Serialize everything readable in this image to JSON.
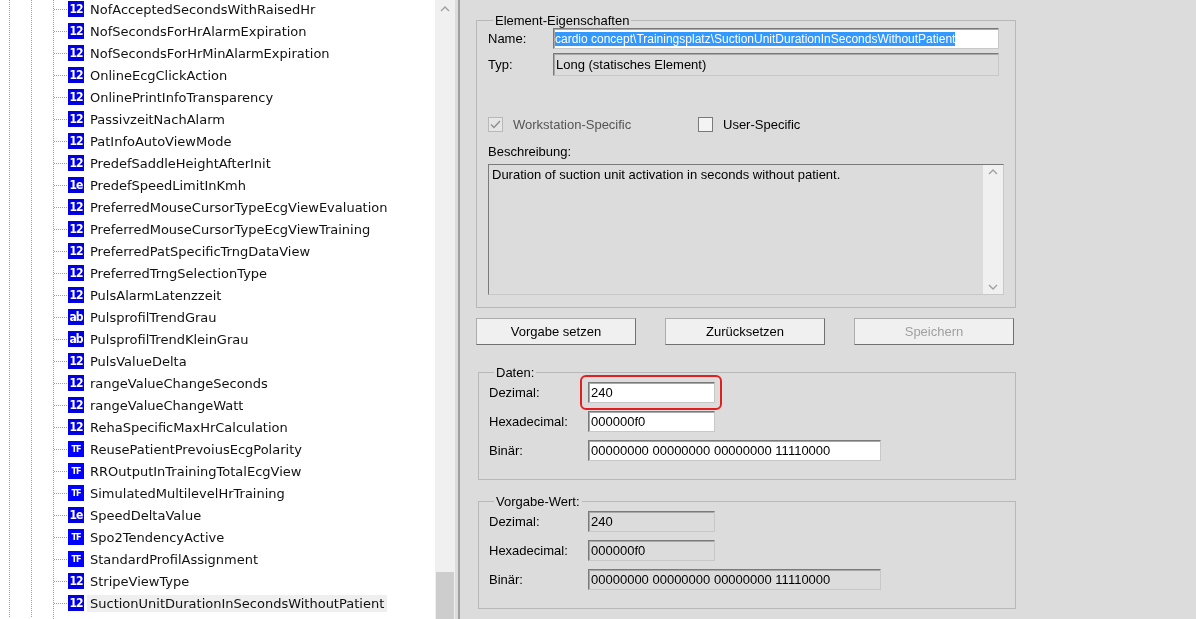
{
  "tree": {
    "items": [
      {
        "label": "NofAcceptedSecondsWithRaisedHr",
        "icon": "12",
        "selected": false
      },
      {
        "label": "NofSecondsForHrAlarmExpiration",
        "icon": "12",
        "selected": false
      },
      {
        "label": "NofSecondsForHrMinAlarmExpiration",
        "icon": "12",
        "selected": false
      },
      {
        "label": "OnlineEcgClickAction",
        "icon": "12",
        "selected": false
      },
      {
        "label": "OnlinePrintInfoTransparency",
        "icon": "12",
        "selected": false
      },
      {
        "label": "PassivzeitNachAlarm",
        "icon": "12",
        "selected": false
      },
      {
        "label": "PatInfoAutoViewMode",
        "icon": "12",
        "selected": false
      },
      {
        "label": "PredefSaddleHeightAfterInit",
        "icon": "12",
        "selected": false
      },
      {
        "label": "PredefSpeedLimitInKmh",
        "icon": "1e",
        "selected": false
      },
      {
        "label": "PreferredMouseCursorTypeEcgViewEvaluation",
        "icon": "12",
        "selected": false
      },
      {
        "label": "PreferredMouseCursorTypeEcgViewTraining",
        "icon": "12",
        "selected": false
      },
      {
        "label": "PreferredPatSpecificTrngDataView",
        "icon": "12",
        "selected": false
      },
      {
        "label": "PreferredTrngSelectionType",
        "icon": "12",
        "selected": false
      },
      {
        "label": "PulsAlarmLatenzzeit",
        "icon": "12",
        "selected": false
      },
      {
        "label": "PulsprofilTrendGrau",
        "icon": "ab",
        "selected": false
      },
      {
        "label": "PulsprofilTrendKleinGrau",
        "icon": "ab",
        "selected": false
      },
      {
        "label": "PulsValueDelta",
        "icon": "12",
        "selected": false
      },
      {
        "label": "rangeValueChangeSeconds",
        "icon": "12",
        "selected": false
      },
      {
        "label": "rangeValueChangeWatt",
        "icon": "12",
        "selected": false
      },
      {
        "label": "RehaSpecificMaxHrCalculation",
        "icon": "12",
        "selected": false
      },
      {
        "label": "ReusePatientPrevoiusEcgPolarity",
        "icon": "TF",
        "selected": false
      },
      {
        "label": "RROutputInTrainingTotalEcgView",
        "icon": "TF",
        "selected": false
      },
      {
        "label": "SimulatedMultilevelHrTraining",
        "icon": "TF",
        "selected": false
      },
      {
        "label": "SpeedDeltaValue",
        "icon": "1e",
        "selected": false
      },
      {
        "label": "Spo2TendencyActive",
        "icon": "TF",
        "selected": false
      },
      {
        "label": "StandardProfilAssignment",
        "icon": "TF",
        "selected": false
      },
      {
        "label": "StripeViewType",
        "icon": "12",
        "selected": false
      },
      {
        "label": "SuctionUnitDurationInSecondsWithoutPatient",
        "icon": "12",
        "selected": true
      }
    ]
  },
  "properties": {
    "title": "Element-Eigenschaften",
    "name": {
      "label": "Name:",
      "value": "cardio concept\\Trainingsplatz\\SuctionUnitDurationInSecondsWithoutPatient",
      "text_selected": true
    },
    "type": {
      "label": "Typ:",
      "value": "Long (statisches Element)"
    },
    "checkboxes": [
      {
        "label": "Workstation-Specific",
        "checked": true,
        "disabled": true
      },
      {
        "label": "User-Specific",
        "checked": false,
        "disabled": false
      }
    ],
    "description": {
      "label": "Beschreibung:",
      "value": "Duration of suction unit activation in seconds without patient."
    }
  },
  "buttons": [
    {
      "label": "Vorgabe setzen",
      "disabled": false
    },
    {
      "label": "Zurücksetzen",
      "disabled": false
    },
    {
      "label": "Speichern",
      "disabled": true
    }
  ],
  "data": {
    "title": "Daten:",
    "readonly": false,
    "fields": [
      {
        "label": "Dezimal:",
        "value": "240",
        "kind": "short",
        "highlighted": true
      },
      {
        "label": "Hexadecimal:",
        "value": "000000f0",
        "kind": "short",
        "highlighted": false
      },
      {
        "label": "Binär:",
        "value": "00000000 00000000 00000000 11110000",
        "kind": "long",
        "highlighted": false
      }
    ]
  },
  "default": {
    "title": "Vorgabe-Wert:",
    "readonly": true,
    "fields": [
      {
        "label": "Dezimal:",
        "value": "240",
        "kind": "short",
        "highlighted": false
      },
      {
        "label": "Hexadecimal:",
        "value": "000000f0",
        "kind": "short",
        "highlighted": false
      },
      {
        "label": "Binär:",
        "value": "00000000 00000000 00000000 11110000",
        "kind": "long",
        "highlighted": false
      }
    ]
  }
}
